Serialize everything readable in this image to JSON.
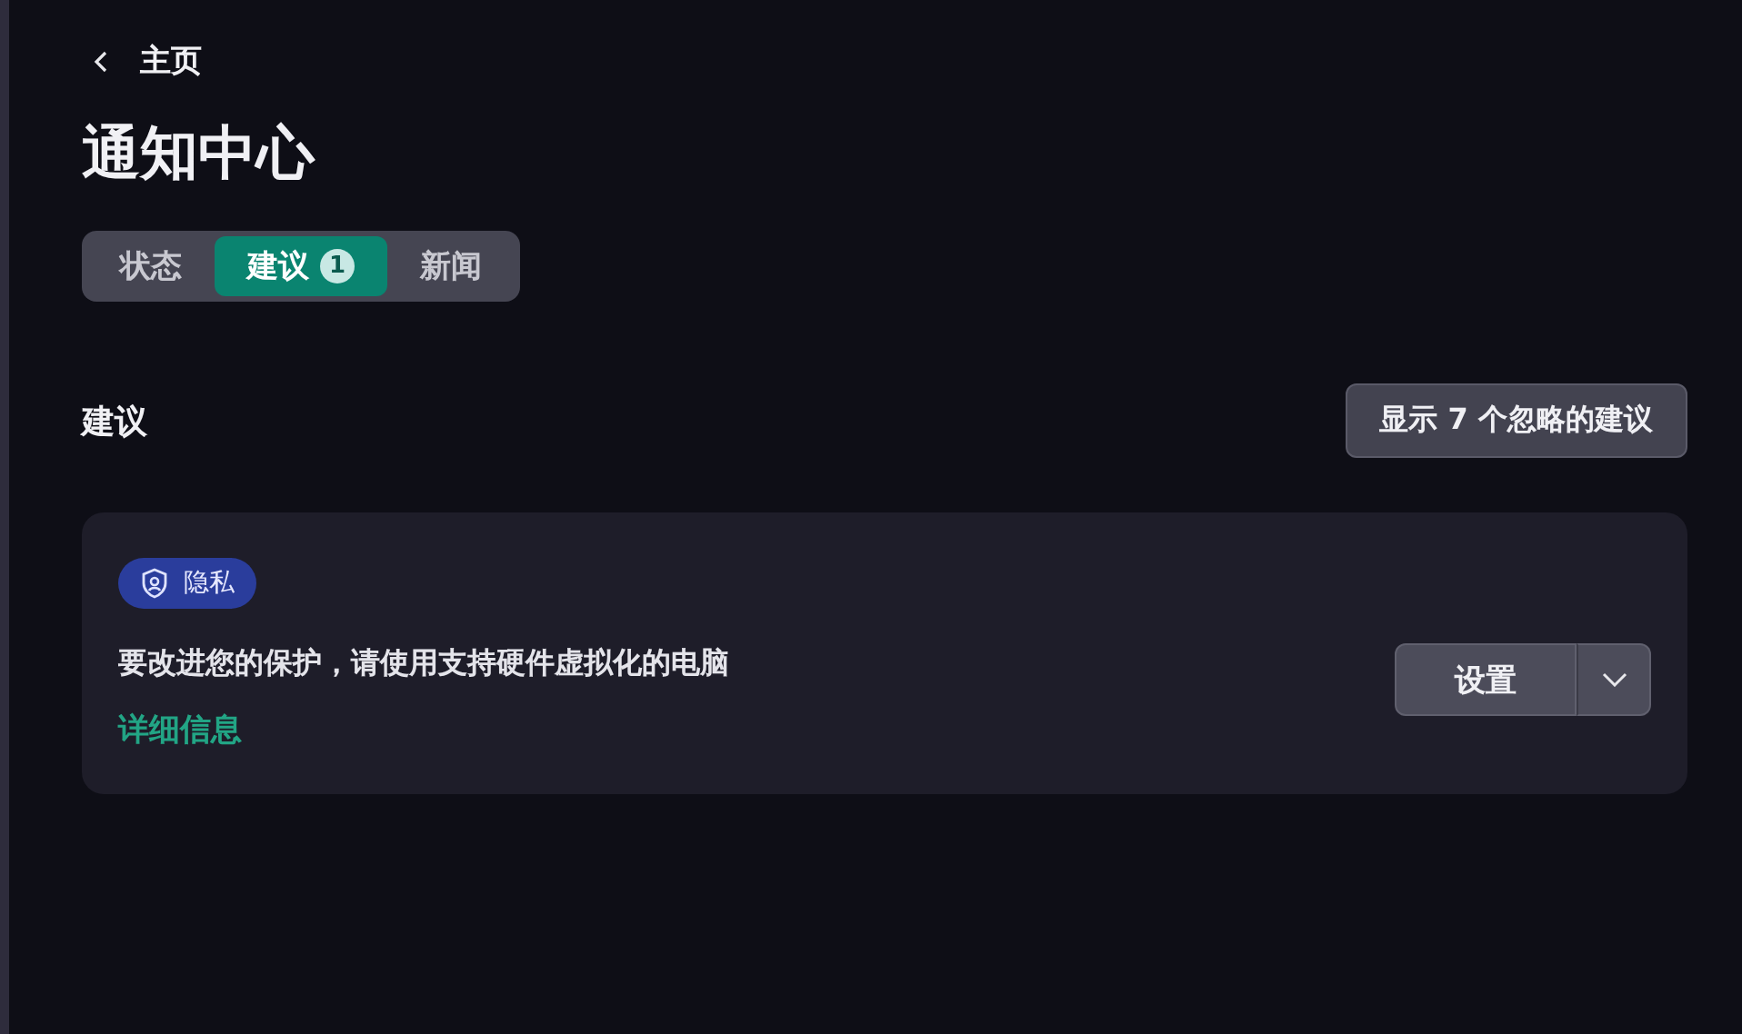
{
  "back": {
    "label": "主页"
  },
  "title": "通知中心",
  "tabs": [
    {
      "label": "状态",
      "selected": false
    },
    {
      "label": "建议",
      "selected": true,
      "badge": "1"
    },
    {
      "label": "新闻",
      "selected": false
    }
  ],
  "section": {
    "heading": "建议",
    "action": "显示 7 个忽略的建议"
  },
  "cards": [
    {
      "tag": "隐私",
      "message": "要改进您的保护，请使用支持硬件虚拟化的电脑",
      "link": "详细信息",
      "button": "设置"
    }
  ]
}
